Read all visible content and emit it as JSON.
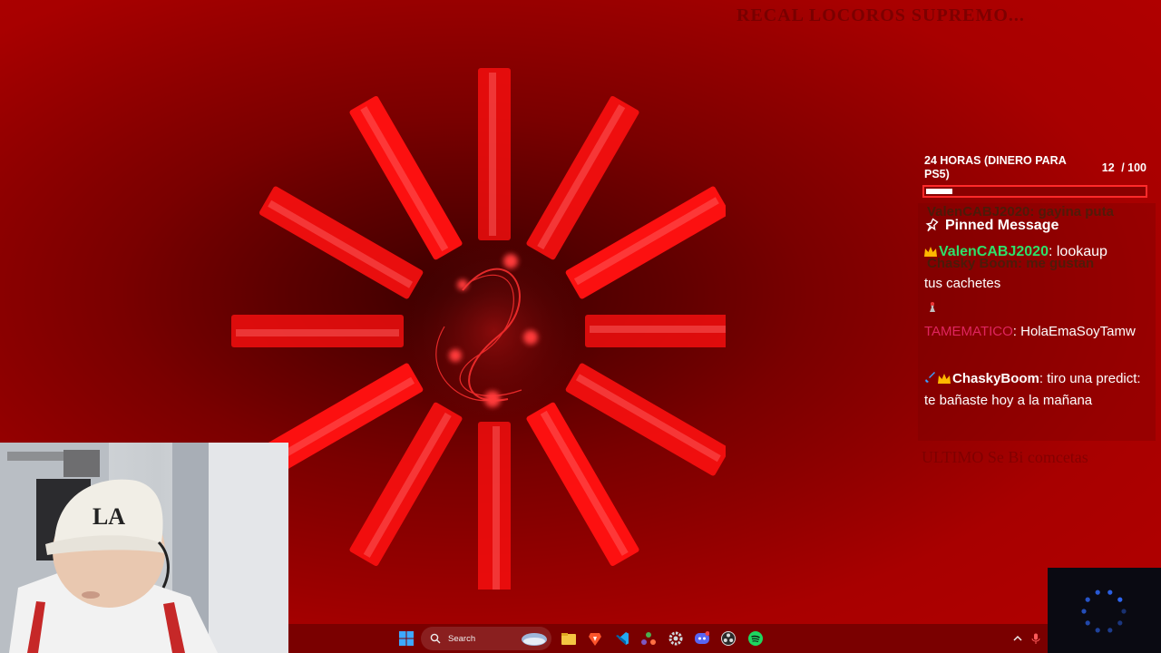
{
  "background": {
    "ticker_text": "RECAL LOCOROS SUPREMO...",
    "ultimo_text": "ULTIMO Se Bi comcetas"
  },
  "goal": {
    "title": "24 HORAS (DINERO PARA PS5)",
    "current": "12",
    "target": "/ 100",
    "progress_fraction": 0.12
  },
  "chat": {
    "ghost_top": "ValenCABJ2020: gayina puta",
    "ghost_mid": "Chasky Boom: me gustan",
    "pinned_label": "Pinned Message",
    "pinned_user": "ValenCABJ2020",
    "pinned_text": ": lookaup",
    "prev_message_tail": "tus cachetes",
    "msg1_user": "TAMEMATICO",
    "msg1_text": ": HolaEmaSoyTamw",
    "msg2_user": "ChaskyBoom",
    "msg2_text": ": tiro una predict: te bañaste hoy a la mañana"
  },
  "taskbar": {
    "search_placeholder": "Search",
    "icons": [
      "windows-start-icon",
      "file-explorer-icon",
      "brave-browser-icon",
      "vscode-icon",
      "network-tool-icon",
      "settings-icon",
      "discord-icon",
      "obs-icon",
      "spotify-icon"
    ],
    "tray_icons": [
      "chevron-up-icon",
      "microphone-icon"
    ]
  },
  "colors": {
    "accent_red": "#ff1a1a",
    "chat_green": "#2ee06a",
    "chat_pink": "#e0245e",
    "goal_border": "#ff2a2a"
  }
}
